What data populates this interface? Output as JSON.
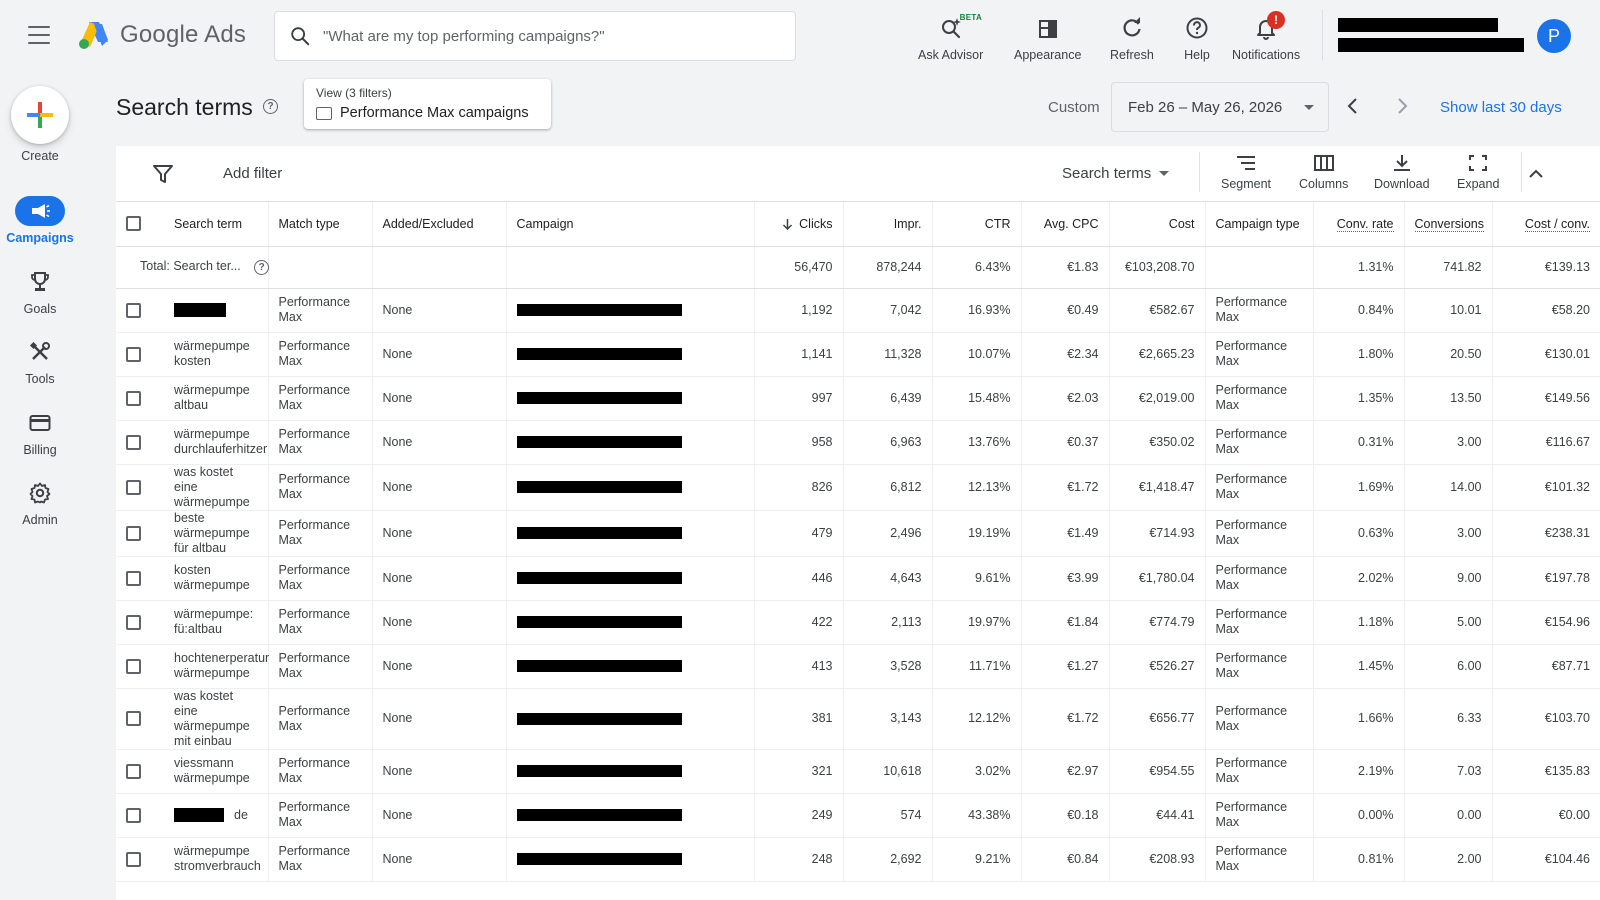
{
  "app": {
    "logo_text": "Google Ads",
    "search_placeholder": "\"What are my top performing campaigns?\""
  },
  "top_actions": {
    "advisor": "Ask Advisor",
    "advisor_badge": "BETA",
    "appearance": "Appearance",
    "refresh": "Refresh",
    "help": "Help",
    "notifications": "Notifications",
    "notifications_badge": "!",
    "avatar_initial": "P"
  },
  "rail": {
    "create": "Create",
    "campaigns": "Campaigns",
    "goals": "Goals",
    "tools": "Tools",
    "billing": "Billing",
    "admin": "Admin"
  },
  "header": {
    "title": "Search terms",
    "help_glyph": "?",
    "view_label": "View (3 filters)",
    "view_value": "Performance Max campaigns",
    "custom": "Custom",
    "date_range": "Feb 26 – May 26, 2026",
    "show_last": "Show last 30 days"
  },
  "toolbar": {
    "add_filter": "Add filter",
    "segment_select": "Search terms",
    "segment": "Segment",
    "columns": "Columns",
    "download": "Download",
    "expand": "Expand"
  },
  "table": {
    "headers": {
      "term": "Search term",
      "match": "Match type",
      "added": "Added/Excluded",
      "campaign": "Campaign",
      "clicks": "Clicks",
      "impr": "Impr.",
      "ctr": "CTR",
      "cpc": "Avg. CPC",
      "cost": "Cost",
      "ctype": "Campaign type",
      "conv_rate": "Conv. rate",
      "conversions": "Conversions",
      "cost_conv": "Cost / conv."
    },
    "total": {
      "label": "Total: Search ter...",
      "clicks": "56,470",
      "impr": "878,244",
      "ctr": "6.43%",
      "cpc": "€1.83",
      "cost": "€103,208.70",
      "conv_rate": "1.31%",
      "conversions": "741.82",
      "cost_conv": "€139.13"
    },
    "rows": [
      {
        "term": "",
        "term_redacted": true,
        "match": "Performance Max",
        "added": "None",
        "clicks": "1,192",
        "impr": "7,042",
        "ctr": "16.93%",
        "cpc": "€0.49",
        "cost": "€582.67",
        "ctype": "Performance Max",
        "conv_rate": "0.84%",
        "conversions": "10.01",
        "cost_conv": "€58.20"
      },
      {
        "term": "wärmepumpe kosten",
        "match": "Performance Max",
        "added": "None",
        "clicks": "1,141",
        "impr": "11,328",
        "ctr": "10.07%",
        "cpc": "€2.34",
        "cost": "€2,665.23",
        "ctype": "Performance Max",
        "conv_rate": "1.80%",
        "conversions": "20.50",
        "cost_conv": "€130.01"
      },
      {
        "term": "wärmepumpe altbau",
        "match": "Performance Max",
        "added": "None",
        "clicks": "997",
        "impr": "6,439",
        "ctr": "15.48%",
        "cpc": "€2.03",
        "cost": "€2,019.00",
        "ctype": "Performance Max",
        "conv_rate": "1.35%",
        "conversions": "13.50",
        "cost_conv": "€149.56"
      },
      {
        "term": "wärmepumpe durchlauferhitzer",
        "match": "Performance Max",
        "added": "None",
        "clicks": "958",
        "impr": "6,963",
        "ctr": "13.76%",
        "cpc": "€0.37",
        "cost": "€350.02",
        "ctype": "Performance Max",
        "conv_rate": "0.31%",
        "conversions": "3.00",
        "cost_conv": "€116.67"
      },
      {
        "term": "was kostet eine wärmepumpe",
        "match": "Performance Max",
        "added": "None",
        "clicks": "826",
        "impr": "6,812",
        "ctr": "12.13%",
        "cpc": "€1.72",
        "cost": "€1,418.47",
        "ctype": "Performance Max",
        "conv_rate": "1.69%",
        "conversions": "14.00",
        "cost_conv": "€101.32"
      },
      {
        "term": "beste wärmepumpe für altbau",
        "match": "Performance Max",
        "added": "None",
        "clicks": "479",
        "impr": "2,496",
        "ctr": "19.19%",
        "cpc": "€1.49",
        "cost": "€714.93",
        "ctype": "Performance Max",
        "conv_rate": "0.63%",
        "conversions": "3.00",
        "cost_conv": "€238.31"
      },
      {
        "term": "kosten wärmepumpe",
        "match": "Performance Max",
        "added": "None",
        "clicks": "446",
        "impr": "4,643",
        "ctr": "9.61%",
        "cpc": "€3.99",
        "cost": "€1,780.04",
        "ctype": "Performance Max",
        "conv_rate": "2.02%",
        "conversions": "9.00",
        "cost_conv": "€197.78"
      },
      {
        "term": "wärmepumpe: fü:altbau",
        "match": "Performance Max",
        "added": "None",
        "clicks": "422",
        "impr": "2,113",
        "ctr": "19.97%",
        "cpc": "€1.84",
        "cost": "€774.79",
        "ctype": "Performance Max",
        "conv_rate": "1.18%",
        "conversions": "5.00",
        "cost_conv": "€154.96"
      },
      {
        "term": "hochtenerperatur wärmepumpe",
        "match": "Performance Max",
        "added": "None",
        "clicks": "413",
        "impr": "3,528",
        "ctr": "11.71%",
        "cpc": "€1.27",
        "cost": "€526.27",
        "ctype": "Performance Max",
        "conv_rate": "1.45%",
        "conversions": "6.00",
        "cost_conv": "€87.71"
      },
      {
        "term": "was kostet eine wärmepumpe mit einbau",
        "match": "Performance Max",
        "added": "None",
        "clicks": "381",
        "impr": "3,143",
        "ctr": "12.12%",
        "cpc": "€1.72",
        "cost": "€656.77",
        "ctype": "Performance Max",
        "conv_rate": "1.66%",
        "conversions": "6.33",
        "cost_conv": "€103.70"
      },
      {
        "term": "viessmann wärmepumpe",
        "match": "Performance Max",
        "added": "None",
        "clicks": "321",
        "impr": "10,618",
        "ctr": "3.02%",
        "cpc": "€2.97",
        "cost": "€954.55",
        "ctype": "Performance Max",
        "conv_rate": "2.19%",
        "conversions": "7.03",
        "cost_conv": "€135.83"
      },
      {
        "term": "de",
        "term_redacted": true,
        "match": "Performance Max",
        "added": "None",
        "clicks": "249",
        "impr": "574",
        "ctr": "43.38%",
        "cpc": "€0.18",
        "cost": "€44.41",
        "ctype": "Performance Max",
        "conv_rate": "0.00%",
        "conversions": "0.00",
        "cost_conv": "€0.00"
      },
      {
        "term": "wärmepumpe stromverbrauch",
        "match": "Performance Max",
        "added": "None",
        "clicks": "248",
        "impr": "2,692",
        "ctr": "9.21%",
        "cpc": "€0.84",
        "cost": "€208.93",
        "ctype": "Performance Max",
        "conv_rate": "0.81%",
        "conversions": "2.00",
        "cost_conv": "€104.46"
      }
    ]
  },
  "colors": {
    "accent": "#1a73e8",
    "background": "#f1f3f4",
    "badge": "#d93025"
  }
}
